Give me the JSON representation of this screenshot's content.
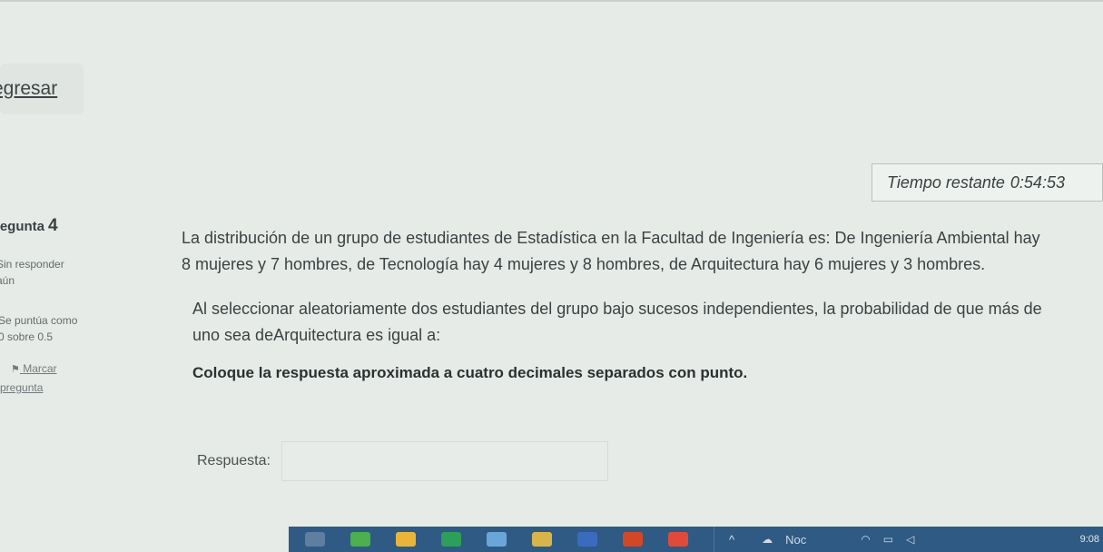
{
  "nav": {
    "back_label": "egresar"
  },
  "timer": {
    "label": "Tiempo restante",
    "value": "0:54:53"
  },
  "question_info": {
    "number_label": "regunta",
    "number": "4",
    "state_line1": "Sin responder",
    "state_line2": "aún",
    "grade_line1": "Se puntúa como",
    "grade_line2": "0 sobre 0.5",
    "flag_line1": "Marcar",
    "flag_line2": "pregunta"
  },
  "question": {
    "paragraph1": "La distribución de un grupo de estudiantes de Estadística en la Facultad de Ingeniería es: De Ingeniería Ambiental hay 8 mujeres y 7 hombres, de Tecnología hay 4 mujeres y 8 hombres, de Arquitectura hay 6 mujeres y 3 hombres.",
    "paragraph2": "Al seleccionar aleatoriamente dos estudiantes del grupo bajo sucesos independientes, la probabilidad de que más de uno sea deArquitectura es igual a:",
    "instruction": "Coloque la respuesta aproximada a cuatro decimales separados con punto."
  },
  "answer": {
    "label": "Respuesta:",
    "value": ""
  },
  "taskbar": {
    "tray_text": "Noc",
    "clock": "9:08",
    "icons": [
      "task-view-icon",
      "browser-icon",
      "file-explorer-icon",
      "spreadsheet-icon",
      "app-icon",
      "folder-icon",
      "word-icon",
      "powerpoint-icon",
      "chrome-icon"
    ],
    "colors": [
      "#5f7fa0",
      "#4caf50",
      "#e8b53a",
      "#2e9e5b",
      "#6aa7d8",
      "#d9b44a",
      "#3b6bbd",
      "#d24726",
      "#e04a3a"
    ]
  }
}
